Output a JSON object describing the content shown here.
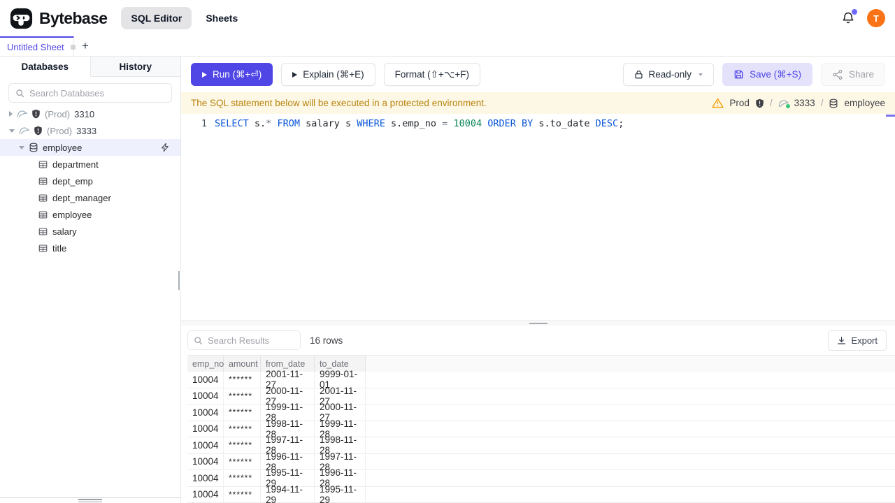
{
  "colors": {
    "accent": "#4f46e5",
    "accent_light": "#e4e2fb",
    "warning_bg": "#fdf8e6",
    "warning_text": "#b8820b",
    "avatar_bg": "#f97316",
    "keyword": "#0b57d7",
    "number": "#098658",
    "selected_row": "#eef0fe"
  },
  "header": {
    "brand": "Bytebase",
    "nav": [
      {
        "label": "SQL Editor"
      },
      {
        "label": "Sheets"
      }
    ],
    "avatar_initial": "T"
  },
  "tabbar": {
    "active_tab": "Untitled Sheet",
    "new_tab_label": "+"
  },
  "sidebar": {
    "tabs": [
      {
        "label": "Databases"
      },
      {
        "label": "History"
      }
    ],
    "search_placeholder": "Search Databases",
    "tree": {
      "instances": [
        {
          "env": "(Prod)",
          "name": "3310"
        },
        {
          "env": "(Prod)",
          "name": "3333"
        }
      ],
      "database": {
        "name": "employee"
      },
      "tables": [
        "department",
        "dept_emp",
        "dept_manager",
        "employee",
        "salary",
        "title"
      ]
    }
  },
  "toolbar": {
    "run_label": "Run (⌘+⏎)",
    "explain_label": "Explain (⌘+E)",
    "format_label": "Format (⇧+⌥+F)",
    "readonly_label": "Read-only",
    "save_label": "Save (⌘+S)",
    "share_label": "Share"
  },
  "banner": {
    "message": "The SQL statement below will be executed in a protected environment.",
    "environment": "Prod",
    "instance": "3333",
    "database": "employee",
    "separator": "/"
  },
  "editor": {
    "line_number": "1",
    "sql": "SELECT s.* FROM salary s WHERE s.emp_no = 10004 ORDER BY s.to_date DESC;",
    "tokens": [
      {
        "text": "SELECT",
        "type": "kw"
      },
      {
        "text": " s.",
        "type": "plain"
      },
      {
        "text": "*",
        "type": "op"
      },
      {
        "text": " ",
        "type": "plain"
      },
      {
        "text": "FROM",
        "type": "kw"
      },
      {
        "text": " salary s ",
        "type": "plain"
      },
      {
        "text": "WHERE",
        "type": "kw"
      },
      {
        "text": " s.emp_no ",
        "type": "plain"
      },
      {
        "text": "=",
        "type": "op"
      },
      {
        "text": " ",
        "type": "plain"
      },
      {
        "text": "10004",
        "type": "num"
      },
      {
        "text": " ",
        "type": "plain"
      },
      {
        "text": "ORDER BY",
        "type": "kw"
      },
      {
        "text": " s.to_date ",
        "type": "plain"
      },
      {
        "text": "DESC",
        "type": "kw"
      },
      {
        "text": ";",
        "type": "plain"
      }
    ]
  },
  "results": {
    "search_placeholder": "Search Results",
    "row_count": "16 rows",
    "export_label": "Export",
    "columns": [
      "emp_no",
      "amount",
      "from_date",
      "to_date"
    ],
    "rows": [
      [
        "10004",
        "******",
        "2001-11-27",
        "9999-01-01"
      ],
      [
        "10004",
        "******",
        "2000-11-27",
        "2001-11-27"
      ],
      [
        "10004",
        "******",
        "1999-11-28",
        "2000-11-27"
      ],
      [
        "10004",
        "******",
        "1998-11-28",
        "1999-11-28"
      ],
      [
        "10004",
        "******",
        "1997-11-28",
        "1998-11-28"
      ],
      [
        "10004",
        "******",
        "1996-11-28",
        "1997-11-28"
      ],
      [
        "10004",
        "******",
        "1995-11-29",
        "1996-11-28"
      ],
      [
        "10004",
        "******",
        "1994-11-29",
        "1995-11-29"
      ]
    ]
  }
}
